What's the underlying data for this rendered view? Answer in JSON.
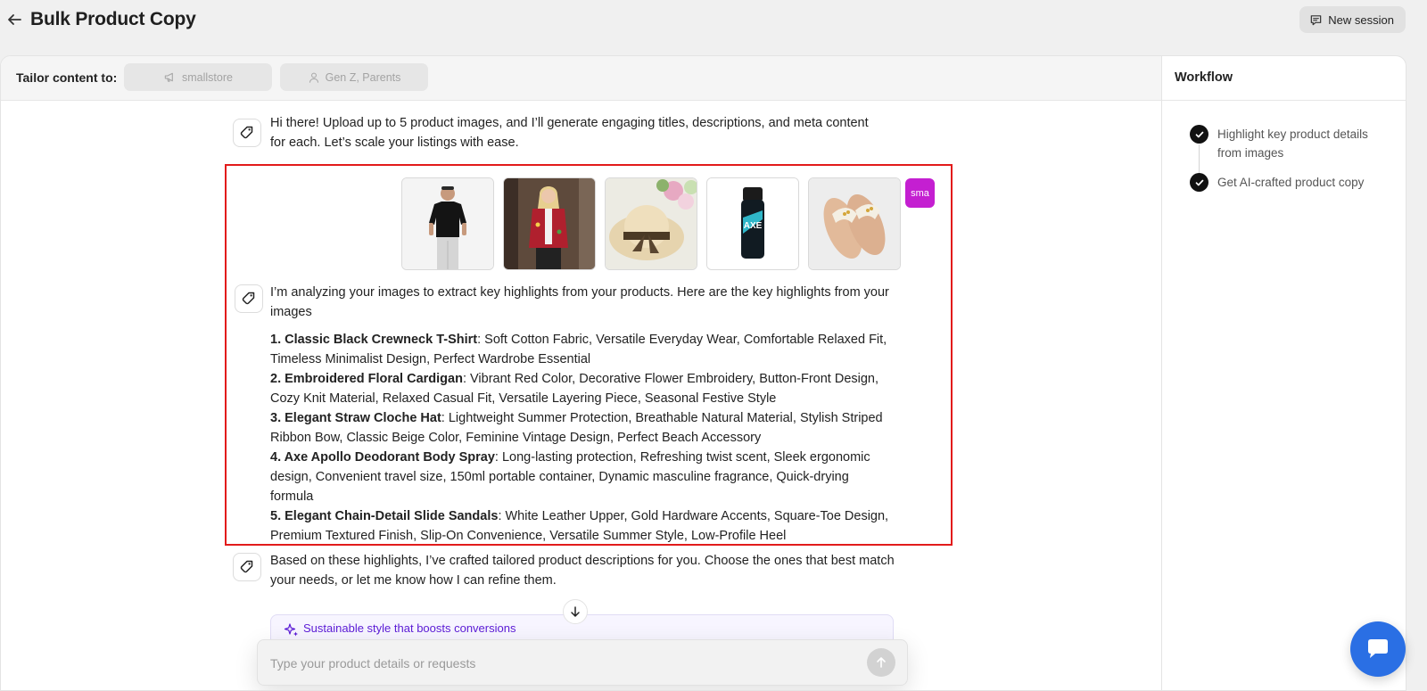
{
  "header": {
    "title": "Bulk Product Copy",
    "new_session_label": "New session"
  },
  "tailor": {
    "label": "Tailor content to:",
    "store": "smallstore",
    "audience": "Gen Z, Parents"
  },
  "chat": {
    "greeting": "Hi there! Upload up to 5 product images, and I’ll generate engaging titles, descriptions, and meta content for each. Let’s scale your listings with ease.",
    "uploaded_images": [
      {
        "name": "black t-shirt photo"
      },
      {
        "name": "red cardigan photo"
      },
      {
        "name": "straw hat photo"
      },
      {
        "name": "deodorant spray photo"
      },
      {
        "name": "slide sandals photo"
      }
    ],
    "user_badge": "sma",
    "analysis_intro": "I’m analyzing your images to extract key highlights from your products. Here are the key highlights from your images",
    "highlights": [
      {
        "title": "1. Classic Black Crewneck T-Shirt",
        "text": ": Soft Cotton Fabric, Versatile Everyday Wear, Comfortable Relaxed Fit, Timeless Minimalist Design, Perfect Wardrobe Essential"
      },
      {
        "title": "2. Embroidered Floral Cardigan",
        "text": ": Vibrant Red Color, Decorative Flower Embroidery, Button-Front Design, Cozy Knit Material, Relaxed Casual Fit, Versatile Layering Piece, Seasonal Festive Style"
      },
      {
        "title": "3. Elegant Straw Cloche Hat",
        "text": ": Lightweight Summer Protection, Breathable Natural Material, Stylish Striped Ribbon Bow, Classic Beige Color, Feminine Vintage Design, Perfect Beach Accessory"
      },
      {
        "title": "4. Axe Apollo Deodorant Body Spray",
        "text": ": Long-lasting protection, Refreshing twist scent, Sleek ergonomic design, Convenient travel size, 150ml portable container, Dynamic masculine fragrance, Quick-drying formula"
      },
      {
        "title": "5. Elegant Chain-Detail Slide Sandals",
        "text": ": White Leather Upper, Gold Hardware Accents, Square-Toe Design, Premium Textured Finish, Slip-On Convenience, Versatile Summer Style, Low-Profile Heel"
      }
    ],
    "followup": "Based on these highlights, I’ve crafted tailored product descriptions for you. Choose the ones that best match your needs, or let me know how I can refine them.",
    "suggestion_title": "Sustainable style that boosts conversions",
    "input_placeholder": "Type your product details or requests",
    "can_label": "AXE"
  },
  "workflow": {
    "title": "Workflow",
    "steps": [
      {
        "label": "Highlight key product details from images",
        "status": "done"
      },
      {
        "label": "Get AI-crafted product copy",
        "status": "done"
      }
    ]
  },
  "colors": {
    "highlight_border": "#e21b1b",
    "user_badge": "#c41fd1",
    "suggestion_accent": "#5b1bd6",
    "fab": "#2a6fe4"
  },
  "icons": {
    "back": "arrow-left-icon",
    "new_session": "chat-bubble-icon",
    "store": "megaphone-icon",
    "audience": "person-icon",
    "bot": "tag-icon",
    "suggestion": "sparkle-icon",
    "scroll": "arrow-down-icon",
    "send": "arrow-up-icon",
    "check": "check-icon",
    "fab": "chat-icon"
  }
}
